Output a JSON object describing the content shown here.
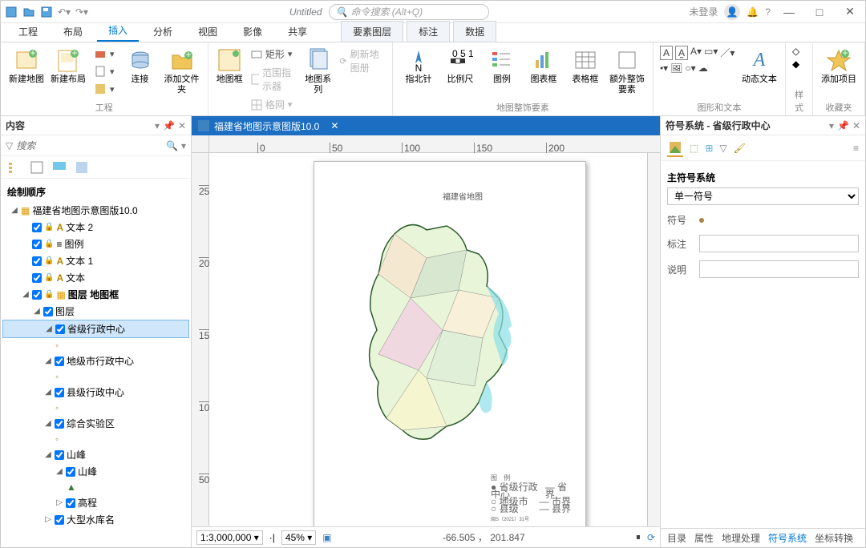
{
  "title": "Untitled",
  "search_placeholder": "命令搜索 (Alt+Q)",
  "login_state": "未登录",
  "tabs": {
    "t0": "工程",
    "t1": "布局",
    "t2": "插入",
    "t3": "分析",
    "t4": "视图",
    "t5": "影像",
    "t6": "共享",
    "t7": "要素图层",
    "t8": "标注",
    "t9": "数据"
  },
  "ribbon": {
    "g_project": "工程",
    "new_map": "新建地图",
    "new_layout": "新建布局",
    "connect": "连接",
    "add_folder": "添加文件夹",
    "g_mapframe": "地图框",
    "mapframe": "地图框",
    "rect": "矩形",
    "extent": "范围指示器",
    "grid": "格网",
    "mapseries": "地图系列",
    "reshape": "刷新地图册",
    "g_surround": "地图整饰要素",
    "north": "指北针",
    "scale": "比例尺",
    "legend": "图例",
    "chartframe": "图表框",
    "tableframe": "表格框",
    "extra": "额外整饰要素",
    "g_graphics": "图形和文本",
    "dyntext": "动态文本",
    "g_style": "样式",
    "g_fav": "收藏夹",
    "additem": "添加项目"
  },
  "contents": {
    "title": "内容",
    "search": "搜索",
    "draw_order": "绘制顺序",
    "root": "福建省地图示意图版10.0",
    "text2": "文本 2",
    "legend": "图例",
    "text1": "文本 1",
    "text": "文本",
    "layer_frame": "图层 地图框",
    "layer": "图层",
    "prov": "省级行政中心",
    "city": "地级市行政中心",
    "county": "县级行政中心",
    "zone": "综合实验区",
    "peak": "山峰",
    "elev": "高程",
    "reservoir": "大型水库名"
  },
  "doc_tab": "福建省地图示意图版10.0",
  "map_title": "福建省地图",
  "legend_title": "图 例",
  "statusbar": {
    "scale": "1:3,000,000",
    "zoom": "45%",
    "coords": "-66.505 ， 201.847"
  },
  "sym": {
    "title": "符号系统 - 省级行政中心",
    "main": "主符号系统",
    "single": "单一符号",
    "symbol": "符号",
    "label": "标注",
    "desc": "说明"
  },
  "bottom": {
    "toc": "目录",
    "attr": "属性",
    "geo": "地理处理",
    "sym": "符号系统",
    "coord": "坐标转换"
  }
}
